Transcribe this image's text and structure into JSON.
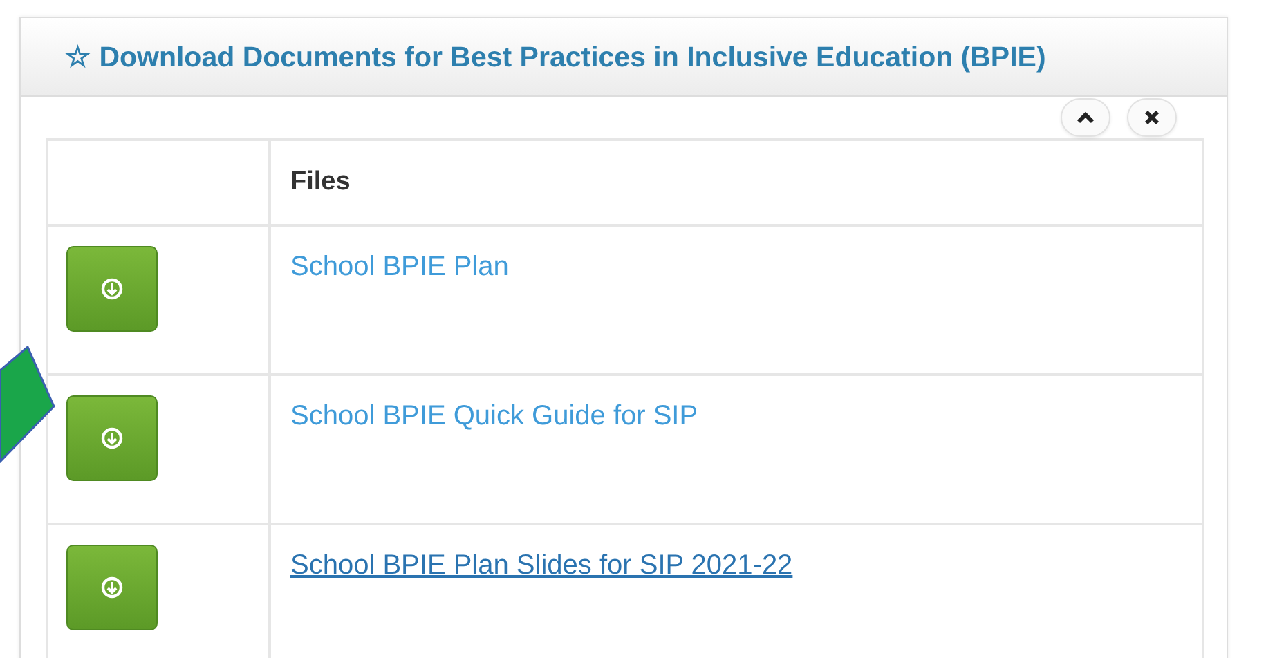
{
  "panel": {
    "title": "Download Documents for Best Practices in Inclusive Education (BPIE)",
    "title_icon": "☆"
  },
  "table": {
    "columns": [
      "Files"
    ],
    "rows": [
      {
        "file": "School BPIE Plan",
        "hovered": false
      },
      {
        "file": "School BPIE Quick Guide for SIP",
        "hovered": false
      },
      {
        "file": "School BPIE Plan Slides for SIP 2021-22",
        "hovered": true
      }
    ]
  }
}
